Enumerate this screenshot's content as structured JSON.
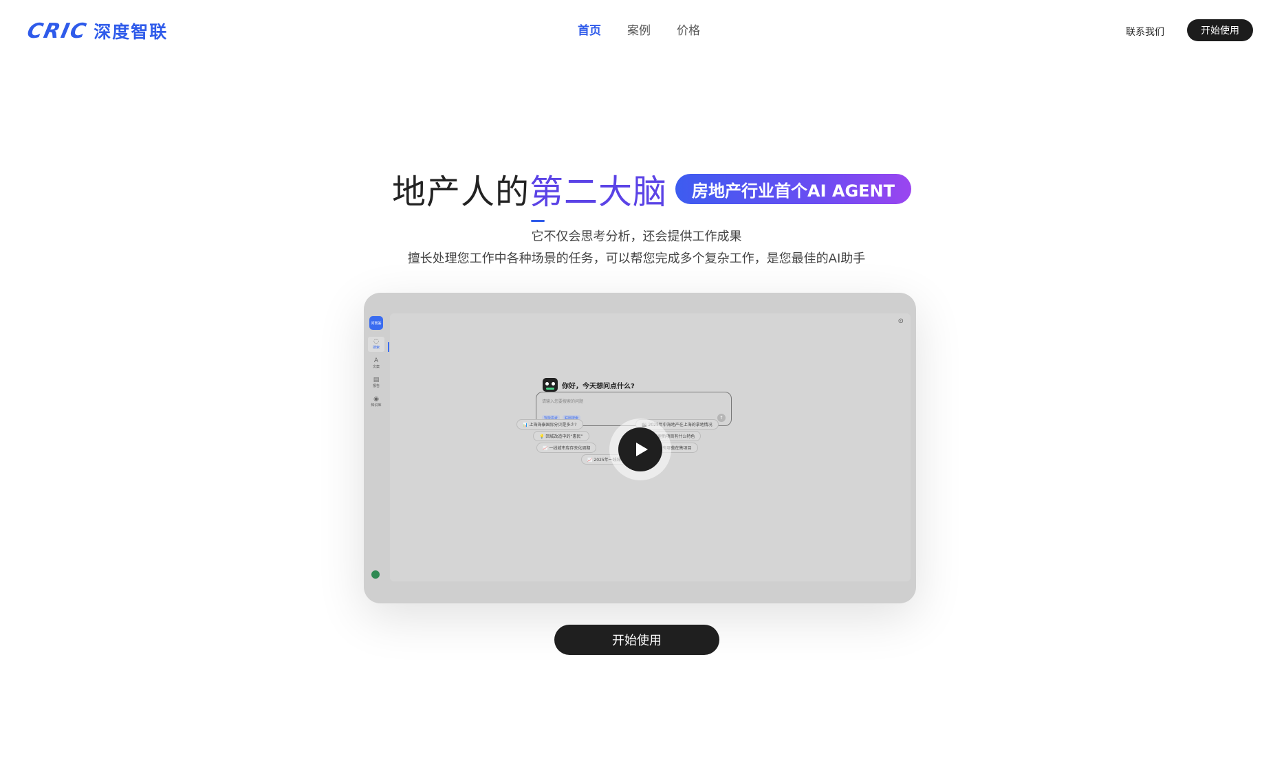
{
  "header": {
    "logo_mark": "CRIC",
    "logo_text": "深度智联",
    "nav": [
      {
        "label": "首页",
        "active": true
      },
      {
        "label": "案例",
        "active": false
      },
      {
        "label": "价格",
        "active": false
      }
    ],
    "contact_label": "联系我们",
    "start_label": "开始使用"
  },
  "hero": {
    "title_plain": "地产人的",
    "title_accent": "第二大脑",
    "badge": "房地产行业首个AI AGENT",
    "subtitle_1": "它不仅会思考分析，还会提供工作成果",
    "subtitle_2": "擅长处理您工作中各种场景的任务，可以帮您完成多个复杂工作，是您最佳的AI助手"
  },
  "video": {
    "app_logo": "问而答",
    "sidebar_items": [
      {
        "icon": "chat-icon",
        "label": "搜索"
      },
      {
        "icon": "doc-icon",
        "label": "文案"
      },
      {
        "icon": "report-icon",
        "label": "报告"
      },
      {
        "icon": "knowledge-icon",
        "label": "知识库"
      }
    ],
    "greeting": "你好，今天想问点什么?",
    "input_placeholder": "请输入您要搜索的问题",
    "chips": [
      "智能思考",
      "联网搜索"
    ],
    "suggestions": [
      "📊 上海海泰国际分贝是多少?",
      "🏙 2025年中海地产在上海的拿地情况",
      "💡 回城改造中的“惠民”",
      "💡 重庆的城市更新项目有什么特色",
      "📈 一线城市库存去化周期",
      "🏘 中海地产在上海有哪些在售项目",
      "📈 2025年一线城市土拍情况?"
    ],
    "colors": {
      "frame": "#cfcfcf",
      "accent": "#3a6cf0"
    }
  },
  "cta_label": "开始使用",
  "colors": {
    "brand": "#2f5bea",
    "accent_text": "#5b43e6",
    "badge_gradient": [
      "#3d5cf0",
      "#9a45f0"
    ],
    "button_dark": "#1c1c1c"
  }
}
